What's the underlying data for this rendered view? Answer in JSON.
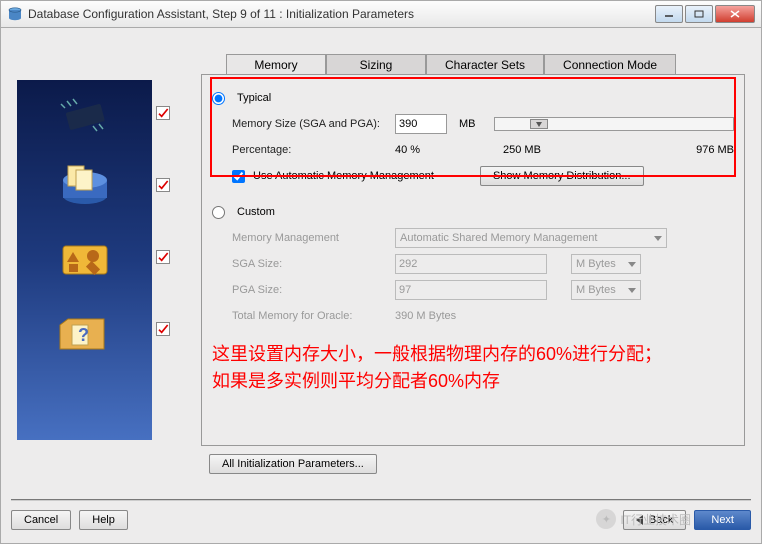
{
  "window": {
    "title": "Database Configuration Assistant, Step 9 of 11 : Initialization Parameters"
  },
  "tabs": {
    "memory": "Memory",
    "sizing": "Sizing",
    "charset": "Character Sets",
    "conn": "Connection Mode"
  },
  "typical": {
    "label": "Typical",
    "memsize_label": "Memory Size (SGA and PGA):",
    "memsize_value": "390",
    "memsize_unit": "MB",
    "percentage_label": "Percentage:",
    "percentage_value": "40 %",
    "slider_min": "250 MB",
    "slider_max": "976 MB",
    "auto_mem": "Use Automatic Memory Management",
    "show_dist": "Show Memory Distribution..."
  },
  "custom": {
    "label": "Custom",
    "mgmt_label": "Memory Management",
    "mgmt_value": "Automatic Shared Memory Management",
    "sga_label": "SGA Size:",
    "sga_value": "292",
    "sga_unit": "M Bytes",
    "pga_label": "PGA Size:",
    "pga_value": "97",
    "pga_unit": "M Bytes",
    "total_label": "Total Memory for Oracle:",
    "total_value": "390 M Bytes"
  },
  "annotation": {
    "line1": "这里设置内存大小，一般根据物理内存的60%进行分配；",
    "line2": "如果是多实例则平均分配者60%内存"
  },
  "all_init": "All Initialization Parameters...",
  "footer": {
    "cancel": "Cancel",
    "help": "Help",
    "back": "Back",
    "next": "Next"
  },
  "watermark": "IT行业技术圈"
}
